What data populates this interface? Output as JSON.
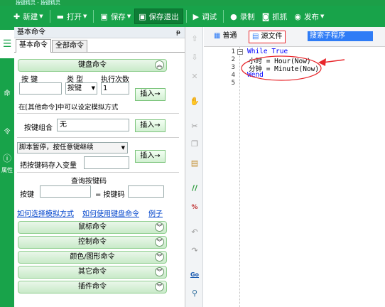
{
  "window": {
    "title": "按键精灵 - 按键精灵"
  },
  "toolbar": {
    "new": "新建",
    "open": "打开",
    "save": "保存",
    "save_exit": "保存退出",
    "debug": "调试",
    "record": "录制",
    "capture": "抓抓",
    "publish": "发布"
  },
  "sidebar": {
    "item1": "命",
    "item2": "令",
    "item3": "属性"
  },
  "panel": {
    "header": "基本命令",
    "pin": "ᵽ",
    "tabs": [
      "基本命令",
      "全部命令"
    ],
    "keyboard": {
      "title": "键盘命令",
      "col_key": "按 键",
      "col_type": "类 型",
      "col_count": "执行次数",
      "type_value": "按键",
      "count_value": "1",
      "insert": "插入→",
      "hint": "在[其他命令]中可以设定模拟方式",
      "combo_label": "按键组合",
      "combo_value": "无",
      "pause_value": "脚本暂停，按任意键继续",
      "store_label": "把按键码存入变量",
      "query_title": "查询按键码",
      "query_key": "按键",
      "query_code": "= 按键码",
      "link1": "如何选择模拟方式",
      "link2": "如何使用键盘命令",
      "link3": "例子"
    },
    "sections": [
      "鼠标命令",
      "控制命令",
      "颜色/图形命令",
      "其它命令",
      "插件命令"
    ]
  },
  "editor": {
    "tab_normal": "普通",
    "tab_source": "源文件",
    "search_placeholder": "搜索子程序",
    "line_numbers": [
      "1",
      "2",
      "3",
      "4",
      "5"
    ],
    "lines": [
      "While True",
      "小时 = Hour(Now)",
      "分钟 = Minute(Now)",
      "Wend"
    ]
  },
  "colors": {
    "accent": "#18a34a",
    "annotation": "#e8262b",
    "keyword": "#0000ff",
    "selection": "#2f7cf6"
  }
}
